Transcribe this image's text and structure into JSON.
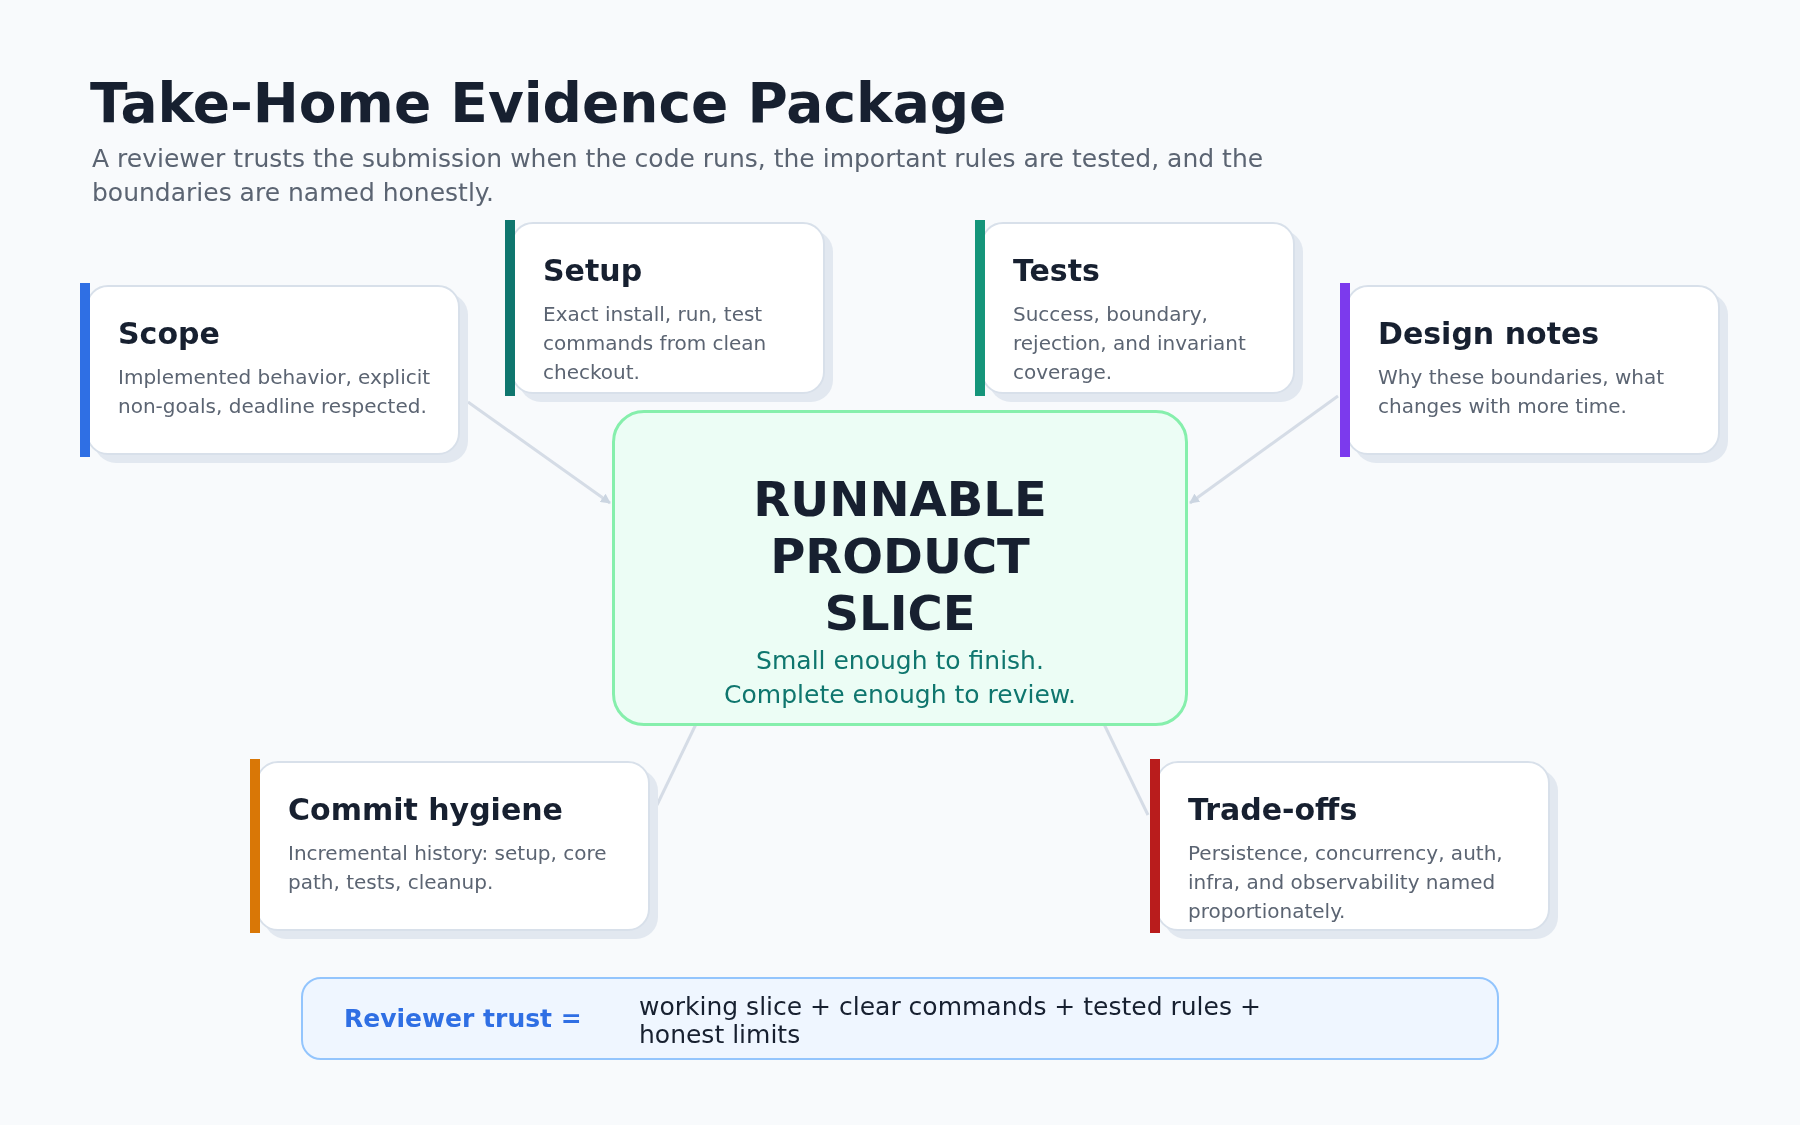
{
  "title": "Take-Home Evidence Package",
  "subtitle": "A reviewer trusts the submission when the code runs, the important rules are tested, and the boundaries are named honestly.",
  "hub": {
    "title": "RUNNABLE PRODUCT SLICE",
    "caption": [
      "Small enough to finish.",
      "Complete enough to review."
    ]
  },
  "cards": [
    {
      "title": "Scope",
      "text": "Implemented behavior, explicit non-goals, deadline respected.",
      "color": "#2f6fe4"
    },
    {
      "title": "Setup",
      "text": "Exact install, run, test commands from clean checkout.",
      "color": "#0f766e"
    },
    {
      "title": "Tests",
      "text": "Success, boundary, rejection, and invariant coverage.",
      "color": "#15957a"
    },
    {
      "title": "Design notes",
      "text": "Why these boundaries, what changes with more time.",
      "color": "#7c3aed"
    },
    {
      "title": "Commit hygiene",
      "text": "Incremental history: setup, core path, tests, cleanup.",
      "color": "#d97706"
    },
    {
      "title": "Trade-offs",
      "text": "Persistence, concurrency, auth, infra, and observability named proportionately.",
      "color": "#b91c1c"
    }
  ],
  "formula": {
    "label": "Reviewer trust =",
    "text": "working slice + clear commands + tested rules + honest limits"
  }
}
